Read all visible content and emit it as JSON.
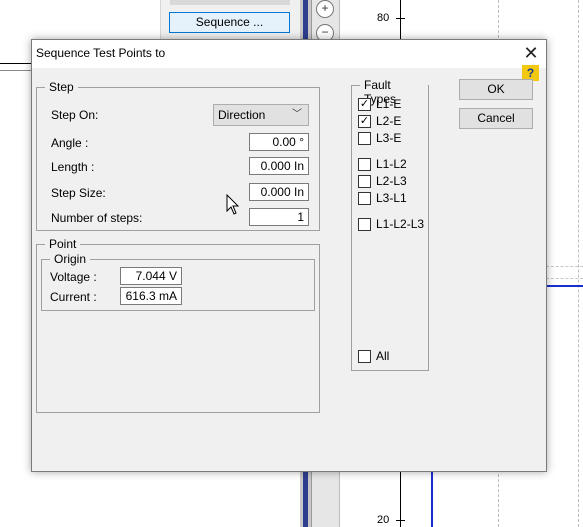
{
  "background": {
    "toolbar": {
      "sequence_button": "Sequence ..."
    },
    "chart": {
      "y_tick_top": "80",
      "y_tick_bottom": "20"
    }
  },
  "dialog": {
    "title": "Sequence Test Points to",
    "help_label": "?",
    "step": {
      "legend": "Step",
      "step_on_label": "Step On:",
      "step_on_value": "Direction",
      "angle_label": "Angle :",
      "angle_value": "0.00 °",
      "length_label": "Length :",
      "length_value": "0.000 In",
      "step_size_label": "Step Size:",
      "step_size_value": "0.000 In",
      "num_steps_label": "Number of steps:",
      "num_steps_value": "1"
    },
    "point": {
      "legend": "Point",
      "origin_legend": "Origin",
      "voltage_label": "Voltage :",
      "voltage_value": "7.044 V",
      "current_label": "Current :",
      "current_value": "616.3 mA"
    },
    "fault_types": {
      "legend": "Fault Types",
      "items": [
        {
          "label": "L1-E",
          "checked": "✓"
        },
        {
          "label": "L2-E",
          "checked": "✓"
        },
        {
          "label": "L3-E",
          "checked": ""
        },
        {
          "label": "L1-L2",
          "checked": ""
        },
        {
          "label": "L2-L3",
          "checked": ""
        },
        {
          "label": "L3-L1",
          "checked": ""
        },
        {
          "label": "L1-L2-L3",
          "checked": ""
        }
      ],
      "all_label": "All",
      "all_checked": ""
    },
    "ok_label": "OK",
    "cancel_label": "Cancel"
  }
}
